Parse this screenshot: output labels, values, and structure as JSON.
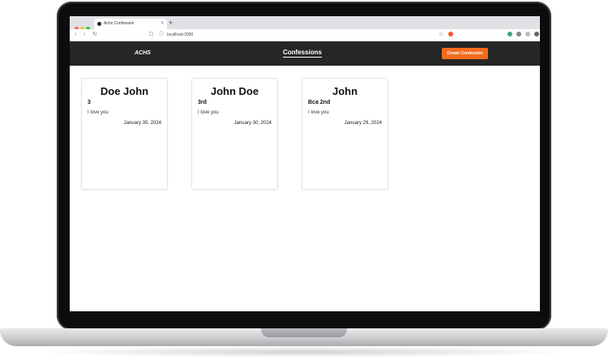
{
  "browser": {
    "tab_title": "Achs Confession",
    "tab_close": "×",
    "new_tab": "+",
    "back": "‹",
    "forward": "›",
    "reload": "↻",
    "bookmark": "☐",
    "url_icon": "ⓘ",
    "url": "localhost:3000"
  },
  "header": {
    "brand": "ACHS",
    "title": "Confessions",
    "create_button": "Create Confession"
  },
  "confessions": [
    {
      "to": "Doe John",
      "class": "3",
      "message": "I love you",
      "date": "January 30, 2024"
    },
    {
      "to": "John Doe",
      "class": "3rd",
      "message": "I love you",
      "date": "January 30, 2024"
    },
    {
      "to": "John",
      "class": "Bca 2nd",
      "message": "I love you",
      "date": "January 29, 2024"
    }
  ],
  "colors": {
    "header_bg": "#262626",
    "accent": "#f26c1b"
  }
}
